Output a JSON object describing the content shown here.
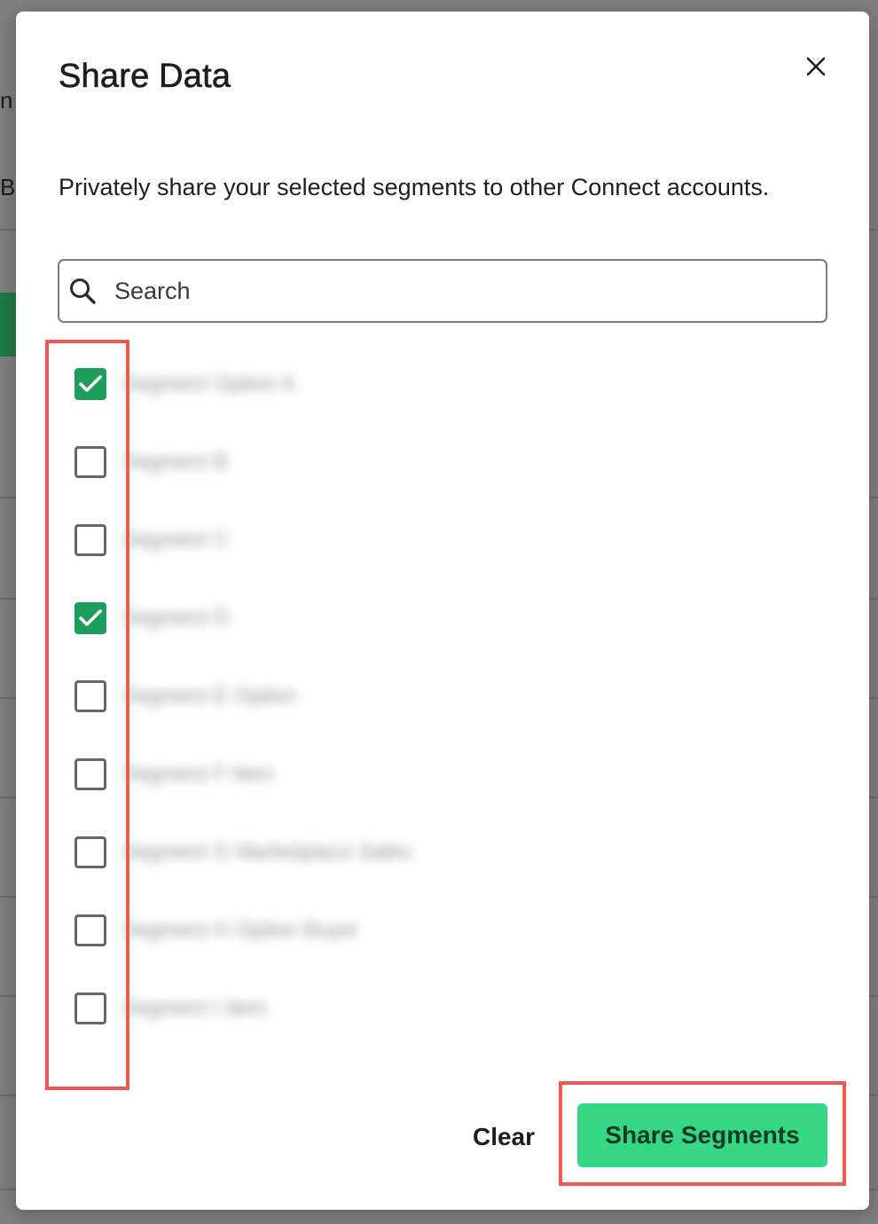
{
  "modal": {
    "title": "Share Data",
    "description": "Privately share your selected segments to other Connect accounts.",
    "search": {
      "placeholder": "Search",
      "value": ""
    },
    "segments": [
      {
        "label": "Segment Option A",
        "checked": true
      },
      {
        "label": "Segment B",
        "checked": false
      },
      {
        "label": "Segment C",
        "checked": false
      },
      {
        "label": "Segment D",
        "checked": true
      },
      {
        "label": "Segment E Option",
        "checked": false
      },
      {
        "label": "Segment F Item",
        "checked": false
      },
      {
        "label": "Segment G Marketplace Sales",
        "checked": false
      },
      {
        "label": "Segment H Option Buyer",
        "checked": false
      },
      {
        "label": "Segment I Item",
        "checked": false
      }
    ],
    "buttons": {
      "clear": "Clear",
      "share": "Share Segments"
    }
  },
  "colors": {
    "accent": "#35d684",
    "checkbox_checked": "#1e9e5c",
    "highlight": "#ee5a4f"
  }
}
